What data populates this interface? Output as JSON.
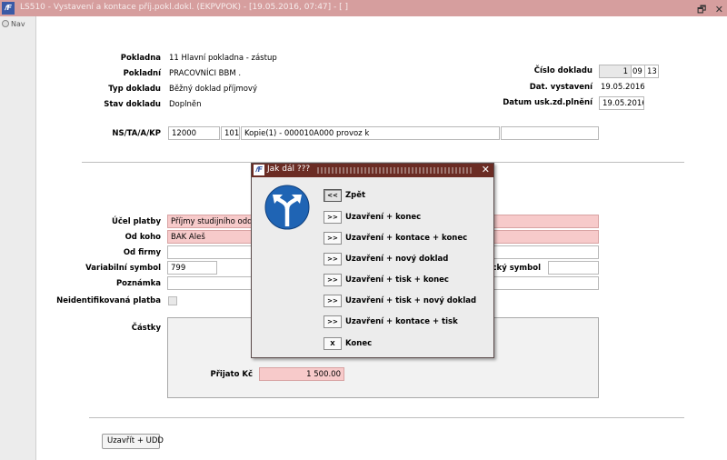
{
  "window": {
    "app_icon": "𝑓F",
    "title": "LS510 - Vystavení a kontace příj.pokl.dokl. (EKPVPOK) - [19.05.2016, 07:47] - [ ]",
    "restore_label": "🗗",
    "close_label": "✕"
  },
  "nav": {
    "label": "Nav"
  },
  "header": {
    "pokladna_label": "Pokladna",
    "pokladna_value": "11 Hlavní pokladna - zástup",
    "pokladni_label": "Pokladní",
    "pokladni_value": "PRACOVNÍCI BBM .",
    "typ_label": "Typ dokladu",
    "typ_value": "Běžný doklad příjmový",
    "stav_label": "Stav dokladu",
    "stav_value": "Doplněn",
    "cislo_label": "Číslo dokladu",
    "cislo_parts": [
      "1",
      "09",
      "13"
    ],
    "dat_vyst_label": "Dat. vystavení",
    "dat_vyst_value": "19.05.2016",
    "datum_usk_label": "Datum usk.zd.plnění",
    "datum_usk_value": "19.05.2016"
  },
  "nstaakp": {
    "label": "NS/TA/A/KP",
    "ns": "12000",
    "ta": "101",
    "a": "Kopie(1) - 000010A000 provoz k",
    "kp": ""
  },
  "details": {
    "ucel_label": "Účel platby",
    "ucel_value": "Příjmy studijního odd.",
    "od_koho_label": "Od koho",
    "od_koho_value": "BAK Aleš",
    "od_firmy_label": "Od firmy",
    "od_firmy_value": "",
    "vs_label": "Variabilní symbol",
    "vs_value": "799",
    "ks_label": "ický symbol",
    "ks_value": "",
    "poznamka_label": "Poznámka",
    "poznamka_value": "",
    "neident_label": "Neidentifikovaná platba"
  },
  "castky": {
    "label": "Částky",
    "prijato_label": "Přijato Kč",
    "prijato_value": "1 500.00"
  },
  "footer": {
    "uzavrit_udd": "Uzavřít + UDD"
  },
  "dialog": {
    "icon": "𝑓F",
    "title": "Jak dál ???",
    "close": "✕",
    "options": [
      {
        "btn": "<<",
        "label": "Zpět"
      },
      {
        "btn": ">>",
        "label": "Uzavření + konec"
      },
      {
        "btn": ">>",
        "label": "Uzavření + kontace + konec"
      },
      {
        "btn": ">>",
        "label": "Uzavření + nový doklad"
      },
      {
        "btn": ">>",
        "label": "Uzavření + tisk + konec"
      },
      {
        "btn": ">>",
        "label": "Uzavření + tisk + nový doklad"
      },
      {
        "btn": ">>",
        "label": "Uzavření + kontace + tisk"
      },
      {
        "btn": "X",
        "label": "Konec"
      }
    ]
  },
  "colors": {
    "titlebar": "#d69e9e",
    "dialog_title": "#6b2c24",
    "required_field": "#f7caca",
    "road_sign": "#1f64b4"
  }
}
